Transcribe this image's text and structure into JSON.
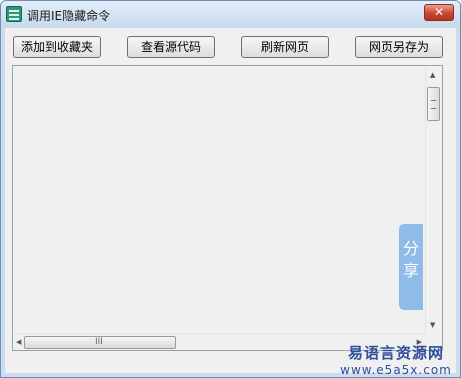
{
  "window": {
    "title": "调用IE隐藏命令",
    "close_glyph": "✕"
  },
  "toolbar": {
    "buttons": [
      "添加到收藏夹",
      "查看源代码",
      "刷新网页",
      "网页另存为"
    ]
  },
  "scrollbars": {
    "up_arrow": "▲",
    "down_arrow": "▼",
    "left_arrow": "◀",
    "right_arrow": "▶",
    "grip": "III"
  },
  "share": {
    "chars": [
      "分",
      "享"
    ]
  },
  "watermark": {
    "title": "易语言资源网",
    "url": "www.e5a5x.com"
  }
}
